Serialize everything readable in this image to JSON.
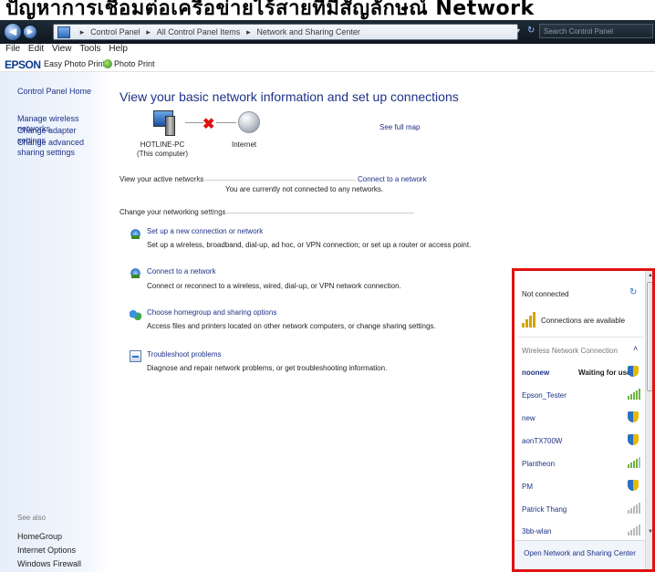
{
  "banner": {
    "text": "ปัญหาการเชื่อมต่อเครือข่ายไร้สายที่มีสัญลักษณ์ Network"
  },
  "address_bar": {
    "crumbs": [
      "Control Panel",
      "All Control Panel Items",
      "Network and Sharing Center"
    ],
    "search_placeholder": "Search Control Panel"
  },
  "menubar": {
    "items": [
      "File",
      "Edit",
      "View",
      "Tools",
      "Help"
    ]
  },
  "epsonbar": {
    "logo": "EPSON",
    "menu": "Easy Photo Print ▾",
    "photo_print": "Photo Print"
  },
  "left_pane": {
    "home": "Control Panel Home",
    "links": [
      "Manage wireless networks",
      "Change adapter settings",
      "Change advanced sharing settings"
    ],
    "see_also_label": "See also",
    "see_also": [
      "HomeGroup",
      "Internet Options",
      "Windows Firewall"
    ]
  },
  "main": {
    "title": "View your basic network information and set up connections",
    "see_full_map": "See full map",
    "computer_name": "HOTLINE-PC",
    "computer_sub": "(This computer)",
    "internet_label": "Internet",
    "active_networks_label": "View your active networks",
    "connect_to_network": "Connect to a network",
    "not_connected_msg": "You are currently not connected to any networks.",
    "change_settings_label": "Change your networking settings",
    "tasks": [
      {
        "title": "Set up a new connection or network",
        "desc": "Set up a wireless, broadband, dial-up, ad hoc, or VPN connection; or set up a router or access point."
      },
      {
        "title": "Connect to a network",
        "desc": "Connect or reconnect to a wireless, wired, dial-up, or VPN network connection."
      },
      {
        "title": "Choose homegroup and sharing options",
        "desc": "Access files and printers located on other network computers, or change sharing settings."
      },
      {
        "title": "Troubleshoot problems",
        "desc": "Diagnose and repair network problems, or get troubleshooting information."
      }
    ]
  },
  "wifi_popup": {
    "status": "Not connected",
    "available": "Connections are available",
    "section": "Wireless Network Connection",
    "networks": [
      {
        "name": "noonew",
        "status": "Waiting for users",
        "secured": true
      },
      {
        "name": "Epson_Tester",
        "status": "",
        "secured": false
      },
      {
        "name": "new",
        "status": "",
        "secured": true
      },
      {
        "name": "aonTX700W",
        "status": "",
        "secured": true
      },
      {
        "name": "Plantheon",
        "status": "",
        "secured": false
      },
      {
        "name": "PM",
        "status": "",
        "secured": true
      },
      {
        "name": "Patrick Thang",
        "status": "",
        "secured": false
      },
      {
        "name": "3bb-wlan",
        "status": "",
        "secured": false
      }
    ],
    "footer_link": "Open Network and Sharing Center"
  }
}
